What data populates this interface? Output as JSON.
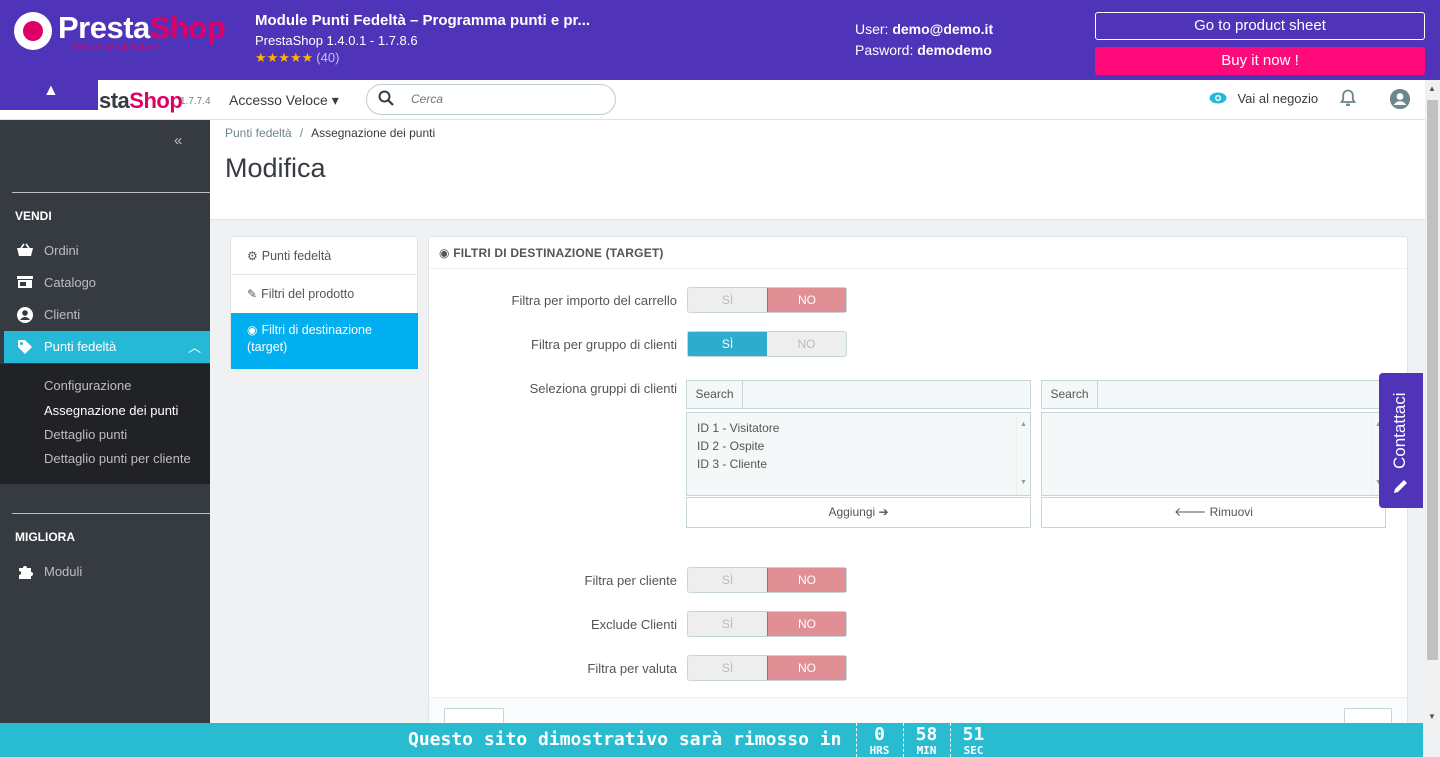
{
  "promo": {
    "logo_presta": "Presta",
    "logo_shop": "Shop",
    "logo_sub": "Addons Marketplace",
    "title": "Module Punti Fedeltà – Programma punti e pr...",
    "version": "PrestaShop 1.4.0.1 - 1.7.8.6",
    "stars": "★★★★★",
    "rating_count": "(40)",
    "user_label": "User:",
    "user_value": "demo@demo.it",
    "password_label": "Pasword:",
    "password_value": "demodemo",
    "product_sheet_button": "Go to product sheet",
    "buy_button": "Buy it now !"
  },
  "header": {
    "collapse_icon": "▲",
    "brand_partial": "sta",
    "brand_shop": "Shop",
    "version": "1.7.7.4",
    "quick_access": "Accesso Veloce ▾",
    "search_placeholder": "Cerca",
    "view_shop": "Vai al negozio",
    "icons": {
      "search": "search-icon",
      "eye": "eye-icon",
      "bell": "bell-icon",
      "avatar": "account-icon"
    }
  },
  "sidebar": {
    "collapse": "«",
    "section_sell": "VENDI",
    "items": [
      {
        "label": "Ordini",
        "icon": "basket-icon"
      },
      {
        "label": "Catalogo",
        "icon": "store-icon"
      },
      {
        "label": "Clienti",
        "icon": "account-circle-icon"
      },
      {
        "label": "Punti fedeltà",
        "icon": "tag-icon"
      }
    ],
    "subitems": [
      "Configurazione",
      "Assegnazione dei punti",
      "Dettaglio punti",
      "Dettaglio punti per cliente"
    ],
    "section_improve": "MIGLIORA",
    "modules": "Moduli"
  },
  "page": {
    "breadcrumb": [
      "Punti fedeltà",
      "Assegnazione dei punti"
    ],
    "breadcrumb_sep": "/",
    "title": "Modifica"
  },
  "tabs": [
    {
      "label": "Punti fedeltà",
      "icon": "cogs-icon"
    },
    {
      "label": "Filtri del prodotto",
      "icon": "edit-icon"
    },
    {
      "label": "Filtri di destinazione (target)",
      "icon": "globe-icon"
    }
  ],
  "panel": {
    "heading": "FILTRI DI DESTINAZIONE (TARGET)",
    "yes": "SÌ",
    "no": "NO",
    "fields": [
      {
        "label": "Filtra per importo del carrello",
        "value": "NO"
      },
      {
        "label": "Filtra per gruppo di clienti",
        "value": "SÌ"
      },
      {
        "label": "Filtra per cliente",
        "value": "NO"
      },
      {
        "label": "Exclude Clienti",
        "value": "NO"
      },
      {
        "label": "Filtra per valuta",
        "value": "NO"
      }
    ],
    "groups_label": "Seleziona gruppi di clienti",
    "search_label": "Search",
    "available_groups": [
      "ID 1 - Visitatore",
      "ID 2 - Ospite",
      "ID 3 - Cliente"
    ],
    "selected_groups": [],
    "add_button": "Aggiungi ➔",
    "remove_button": "🡐 Rimuovi"
  },
  "contact": {
    "label": "Contattaci",
    "icon": "pencil-icon"
  },
  "countdown": {
    "message": "Questo sito dimostrativo sarà rimosso in",
    "hours": "0",
    "hours_label": "HRS",
    "minutes": "58",
    "minutes_label": "MIN",
    "seconds": "51",
    "seconds_label": "SEC"
  }
}
